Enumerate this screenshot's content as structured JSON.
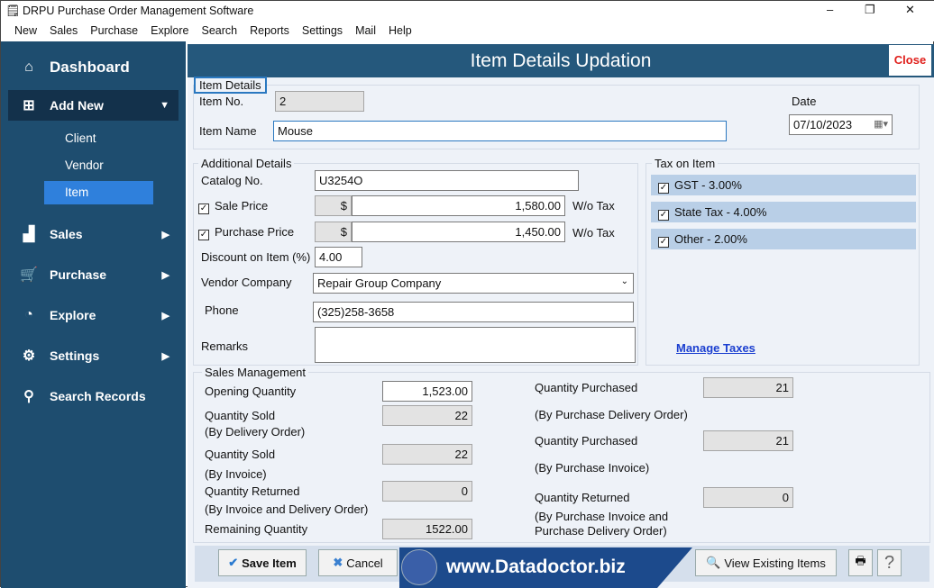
{
  "window": {
    "title": "DRPU Purchase Order Management Software",
    "minimize": "–",
    "maximize": "❐",
    "close": "✕"
  },
  "menu": [
    "New",
    "Sales",
    "Purchase",
    "Explore",
    "Search",
    "Reports",
    "Settings",
    "Mail",
    "Help"
  ],
  "sidebar": {
    "dashboard": "Dashboard",
    "add_new": "Add New",
    "sub": [
      "Client",
      "Vendor",
      "Item"
    ],
    "items": [
      "Sales",
      "Purchase",
      "Explore",
      "Settings",
      "Search Records"
    ]
  },
  "header": {
    "title": "Item Details Updation",
    "close": "Close"
  },
  "item_details": {
    "legend": "Item Details",
    "item_no_label": "Item No.",
    "item_no": "2",
    "item_name_label": "Item Name",
    "item_name": "Mouse",
    "date_label": "Date",
    "date": "07/10/2023"
  },
  "additional": {
    "legend": "Additional Details",
    "catalog_label": "Catalog No.",
    "catalog": "U3254O",
    "sale_label": "Sale Price",
    "currency": "$",
    "sale": "1,580.00",
    "wo_tax": "W/o Tax",
    "purchase_label": "Purchase Price",
    "purchase": "1,450.00",
    "discount_label": "Discount on Item (%)",
    "discount": "4.00",
    "vendor_label": "Vendor Company",
    "vendor": "Repair Group Company",
    "phone_label": "Phone",
    "phone": "(325)258-3658",
    "remarks_label": "Remarks",
    "remarks": ""
  },
  "tax": {
    "legend": "Tax on Item",
    "items": [
      "GST - 3.00%",
      "State Tax - 4.00%",
      "Other - 2.00%"
    ],
    "manage": "Manage Taxes"
  },
  "sales_mgmt": {
    "legend": "Sales Management",
    "opening_label": "Opening Quantity",
    "opening": "1,523.00",
    "sold_do_label": "Quantity Sold",
    "sold_do_sub": "(By Delivery Order)",
    "sold_do": "22",
    "sold_inv_label": "Quantity Sold",
    "sold_inv_sub": "(By Invoice)",
    "sold_inv": "22",
    "ret_label": "Quantity Returned",
    "ret_sub": "(By Invoice and Delivery Order)",
    "ret": "0",
    "remaining_label": "Remaining Quantity",
    "remaining": "1522.00",
    "pur_do_label": "Quantity Purchased",
    "pur_do_sub": "(By Purchase Delivery Order)",
    "pur_do": "21",
    "pur_inv_label": "Quantity Purchased",
    "pur_inv_sub": "(By Purchase Invoice)",
    "pur_inv": "21",
    "pret_label": "Quantity Returned",
    "pret_sub1": "(By Purchase Invoice and",
    "pret_sub2": "Purchase Delivery Order)",
    "pret": "0"
  },
  "footer": {
    "save": "Save Item",
    "cancel": "Cancel",
    "banner": "www.Datadoctor.biz",
    "view": "View Existing Items",
    "help": "?"
  }
}
